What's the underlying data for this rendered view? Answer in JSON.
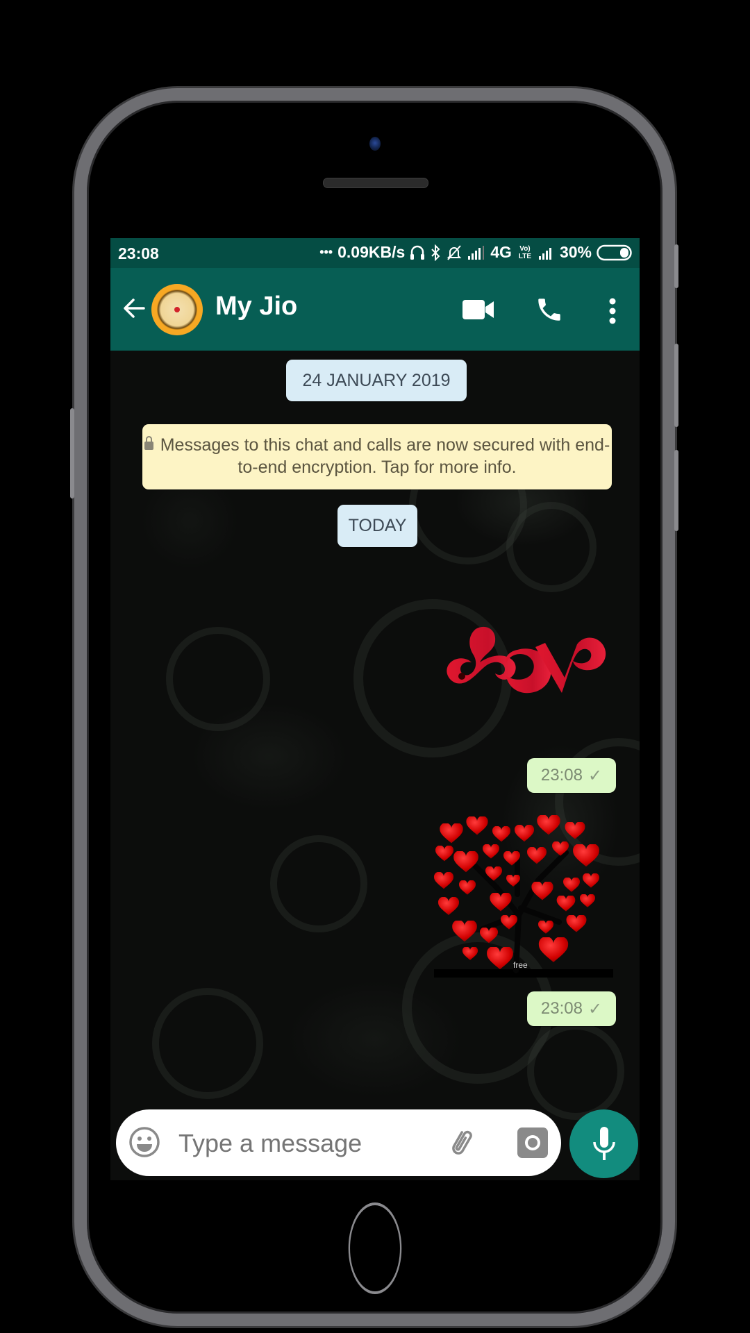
{
  "status_bar": {
    "time": "23:08",
    "dots": "•••",
    "network_speed": "0.09KB/s",
    "network_type": "4G",
    "volte": "Vo) LTE",
    "battery": "30%",
    "icons": [
      "headset-icon",
      "bluetooth-icon",
      "mute-bell-icon",
      "signal-icon",
      "signal-icon-2",
      "battery-icon"
    ]
  },
  "header": {
    "title": "My Jio",
    "back_icon": "arrow-left-icon",
    "actions": [
      "video-call-icon",
      "voice-call-icon",
      "more-vert-icon"
    ]
  },
  "chat": {
    "date_chip": "24 JANUARY 2019",
    "encryption_notice": "Messages to this chat and calls are now secured with end-to-end encryption. Tap for more info.",
    "today_chip": "TODAY",
    "messages": [
      {
        "type": "sticker",
        "content": "love-sticker",
        "time": "23:08",
        "status": "sent",
        "status_glyph": "✓"
      },
      {
        "type": "sticker",
        "content": "heart-tree-sticker",
        "sticker_caption": "free",
        "time": "23:08",
        "status": "sent",
        "status_glyph": "✓"
      }
    ]
  },
  "composer": {
    "placeholder": "Type a message",
    "emoji_icon": "emoji-icon",
    "attach_icon": "paperclip-icon",
    "camera_icon": "camera-icon",
    "mic_icon": "mic-icon"
  },
  "colors": {
    "header": "#075e54",
    "status_bar": "#054d44",
    "date_chip": "#d9ecf6",
    "encryption_notice": "#fdf4c5",
    "outgoing_bubble": "#dcf8c6",
    "mic_button": "#128c7e"
  }
}
